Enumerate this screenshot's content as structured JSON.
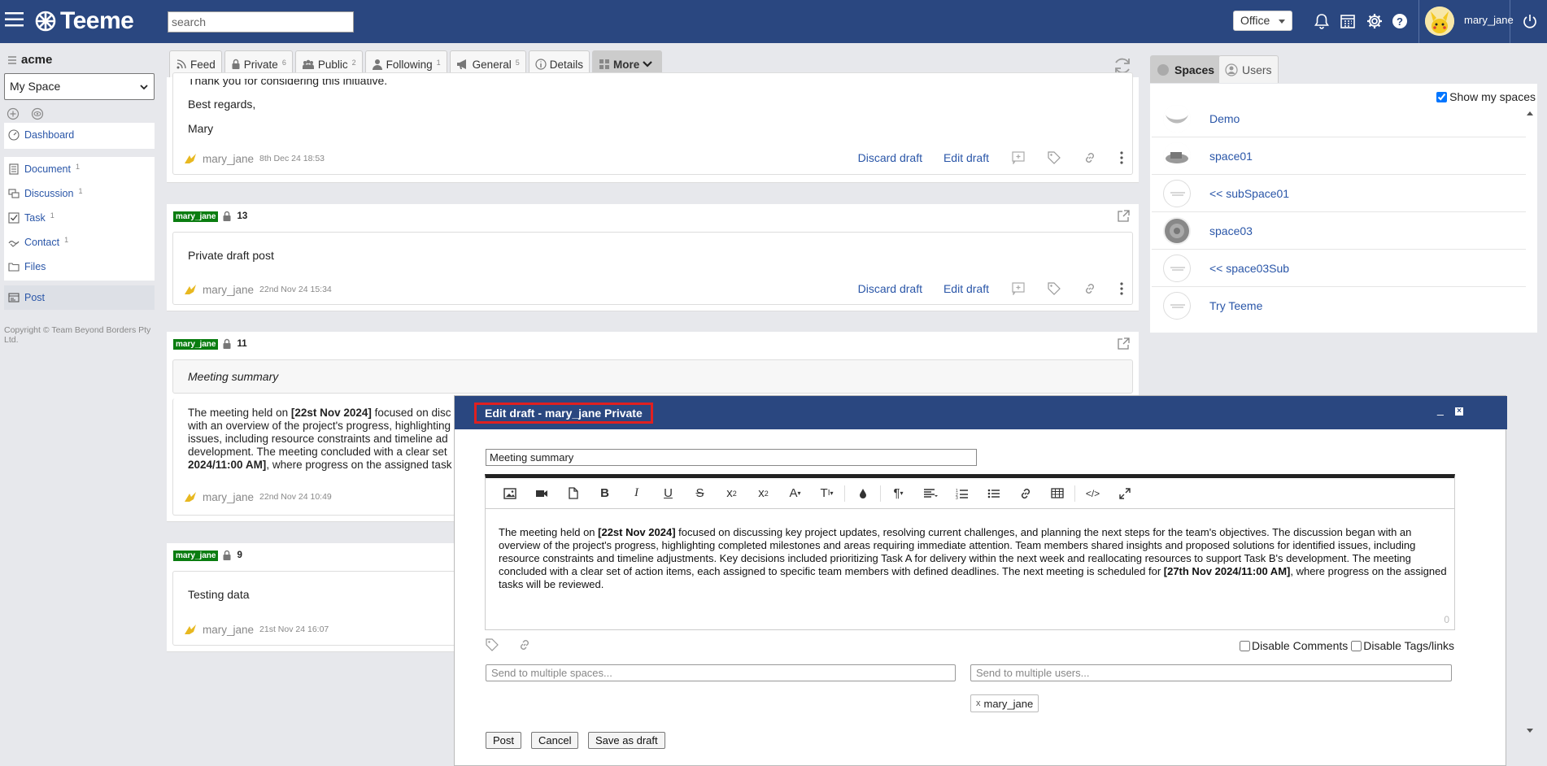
{
  "header": {
    "brand": "Teeme",
    "search_placeholder": "search",
    "office_label": "Office",
    "username": "mary_jane"
  },
  "sidebar": {
    "org": "acme",
    "space_select": "My Space",
    "items": [
      {
        "label": "Dashboard",
        "icon": "dashboard-icon",
        "count": ""
      },
      {
        "label": "Document",
        "icon": "document-icon",
        "count": "1"
      },
      {
        "label": "Discussion",
        "icon": "discussion-icon",
        "count": "1"
      },
      {
        "label": "Task",
        "icon": "task-icon",
        "count": "1"
      },
      {
        "label": "Contact",
        "icon": "contact-icon",
        "count": "1"
      },
      {
        "label": "Files",
        "icon": "folder-icon",
        "count": ""
      },
      {
        "label": "Post",
        "icon": "post-icon",
        "count": ""
      }
    ],
    "copyright": "Copyright © Team Beyond Borders Pty Ltd."
  },
  "feed_tabs": [
    {
      "label": "Feed",
      "count": ""
    },
    {
      "label": "Private",
      "count": "6"
    },
    {
      "label": "Public",
      "count": "2"
    },
    {
      "label": "Following",
      "count": "1"
    },
    {
      "label": "General",
      "count": "5"
    },
    {
      "label": "Details",
      "count": ""
    },
    {
      "label": "More",
      "count": ""
    }
  ],
  "posts": [
    {
      "lines": [
        "Thank you for considering this initiative.",
        "Best regards,",
        "Mary"
      ],
      "author": "mary_jane",
      "date": "8th Dec 24 18:53",
      "discard": "Discard draft",
      "edit": "Edit draft"
    },
    {
      "tag": "mary_jane",
      "num": "13",
      "text": "Private draft post",
      "author": "mary_jane",
      "date": "22nd Nov 24 15:34",
      "discard": "Discard draft",
      "edit": "Edit draft"
    },
    {
      "tag": "mary_jane",
      "num": "11",
      "title": "Meeting summary",
      "body_l1a": "The meeting held on ",
      "body_l1b": "[22st Nov 2024]",
      "body_l1c": " focused on disc",
      "body_l2": "with an overview of the project's progress, highlighting",
      "body_l3": "issues, including resource constraints and timeline ad",
      "body_l4": "development. The meeting concluded with a clear set",
      "body_l5a": "2024/11:00 AM]",
      "body_l5b": ", where progress on the assigned task",
      "author": "mary_jane",
      "date": "22nd Nov 24 10:49"
    },
    {
      "tag": "mary_jane",
      "num": "9",
      "text": "Testing data",
      "author": "mary_jane",
      "date": "21st Nov 24 16:07"
    }
  ],
  "right_panel": {
    "tab_spaces": "Spaces",
    "tab_users": "Users",
    "show_my_spaces": "Show my spaces",
    "spaces": [
      "Demo",
      "space01",
      "<< subSpace01",
      "space03",
      "<< space03Sub",
      "Try Teeme"
    ]
  },
  "modal": {
    "title": "Edit draft - mary_jane Private",
    "minimize": "_",
    "close": "×",
    "subject": "Meeting summary",
    "body_p1": "The meeting held on ",
    "body_b1": "[22st Nov 2024]",
    "body_p2": " focused on discussing key project updates, resolving current challenges, and planning the next steps for the team's objectives. The discussion began with an overview of the project's progress, highlighting completed milestones and areas requiring immediate attention. Team members shared insights and proposed solutions for identified issues, including resource constraints and timeline adjustments. Key decisions included prioritizing Task A for delivery within the next week and reallocating resources to support Task B's development. The meeting concluded with a clear set of action items, each assigned to specific team members with defined deadlines. The next meeting is scheduled for ",
    "body_b2": "[27th Nov 2024/11:00 AM]",
    "body_p3": ", where progress on the assigned tasks will be reviewed.",
    "char_count": "0",
    "disable_comments": "Disable Comments",
    "disable_tags": "Disable Tags/links",
    "spaces_placeholder": "Send to multiple spaces...",
    "users_placeholder": "Send to multiple users...",
    "chip_x": "x",
    "chip_user": "mary_jane",
    "post_btn": "Post",
    "cancel_btn": "Cancel",
    "save_btn": "Save as draft"
  },
  "colors": {
    "header_bg": "#2a4780",
    "link": "#2a56a8",
    "tag_green": "#0a7d10",
    "highlight_red": "#e02020"
  }
}
